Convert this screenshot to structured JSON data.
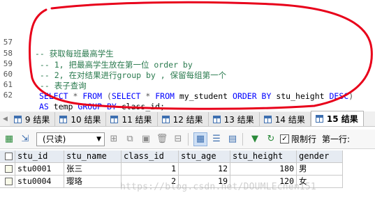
{
  "editor": {
    "lines": [
      {
        "num": "57",
        "text": "-- 获取每班最高学生"
      },
      {
        "num": "58",
        "text": " -- 1, 把最高学生放在第一位 order by"
      },
      {
        "num": "59",
        "text": " -- 2, 在对结果进行group by , 保留每组第一个"
      },
      {
        "num": "60",
        "text": " -- 表子查询"
      },
      {
        "num": "61",
        "parts": [
          "SELECT",
          " * ",
          "FROM",
          " (",
          "SELECT",
          " * ",
          "FROM",
          " my_student ",
          "ORDER BY",
          " stu_height ",
          "DESC",
          ")"
        ]
      },
      {
        "num": "62",
        "parts": [
          "AS",
          " temp ",
          "GROUP BY",
          " class_id;"
        ]
      }
    ]
  },
  "tabs": [
    {
      "label": "9 结果"
    },
    {
      "label": "10 结果"
    },
    {
      "label": "11 结果"
    },
    {
      "label": "12 结果"
    },
    {
      "label": "13 结果"
    },
    {
      "label": "14 结果"
    },
    {
      "label": "15 结果"
    }
  ],
  "toolbar": {
    "mode_select": "(只读)",
    "limit_label": "限制行",
    "first_row_label": "第一行:"
  },
  "grid": {
    "columns": [
      "stu_id",
      "stu_name",
      "class_id",
      "stu_age",
      "stu_height",
      "gender"
    ],
    "rows": [
      [
        "stu0001",
        "张三",
        "1",
        "12",
        "180",
        "男"
      ],
      [
        "stu0004",
        "璎珞",
        "2",
        "19",
        "120",
        "女"
      ]
    ]
  },
  "watermark": "https://blog.csdn.net/DOUMLEchen151",
  "colors": {
    "comment": "#2a7a4e",
    "keyword": "#0000ff",
    "annotation": "#e8001a",
    "header_bg": "#e6ebf2"
  }
}
